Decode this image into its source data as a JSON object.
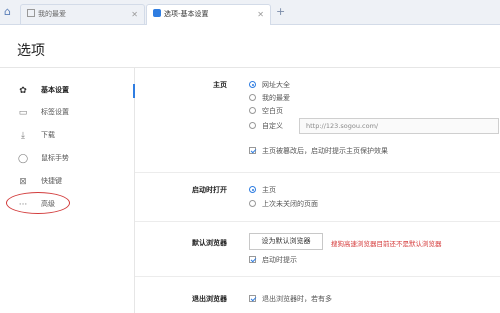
{
  "tabs": [
    {
      "label": "我的最爱"
    },
    {
      "label": "选项-基本设置"
    }
  ],
  "page": {
    "title": "选项"
  },
  "sidebar": {
    "items": [
      {
        "label": "基本设置"
      },
      {
        "label": "标签设置"
      },
      {
        "label": "下载"
      },
      {
        "label": "鼠标手势"
      },
      {
        "label": "快捷键"
      },
      {
        "label": "高级"
      }
    ]
  },
  "sections": {
    "homepage": {
      "label": "主页",
      "options": [
        "网址大全",
        "我的最爱",
        "空白页",
        "自定义"
      ],
      "selected": "网址大全",
      "custom_url": "http://123.sogou.com/",
      "protect_label": "主页被篡改后，启动时提示主页保护效果",
      "protect_checked": true
    },
    "startup": {
      "label": "启动时打开",
      "options": [
        "主页",
        "上次未关闭的页面"
      ],
      "selected": "主页"
    },
    "default_browser": {
      "label": "默认浏览器",
      "button_label": "设为默认浏览器",
      "warning": "搜狗高速浏览器目前还不是默认浏览器",
      "prompt_label": "启动时提示",
      "prompt_checked": true
    },
    "exit": {
      "label": "退出浏览器",
      "option_label": "退出浏览器时，若有多",
      "checked": true
    }
  },
  "colors": {
    "accent": "#2f7de1",
    "warning": "#d53a3a",
    "highlight_oval": "#d23b3b"
  }
}
